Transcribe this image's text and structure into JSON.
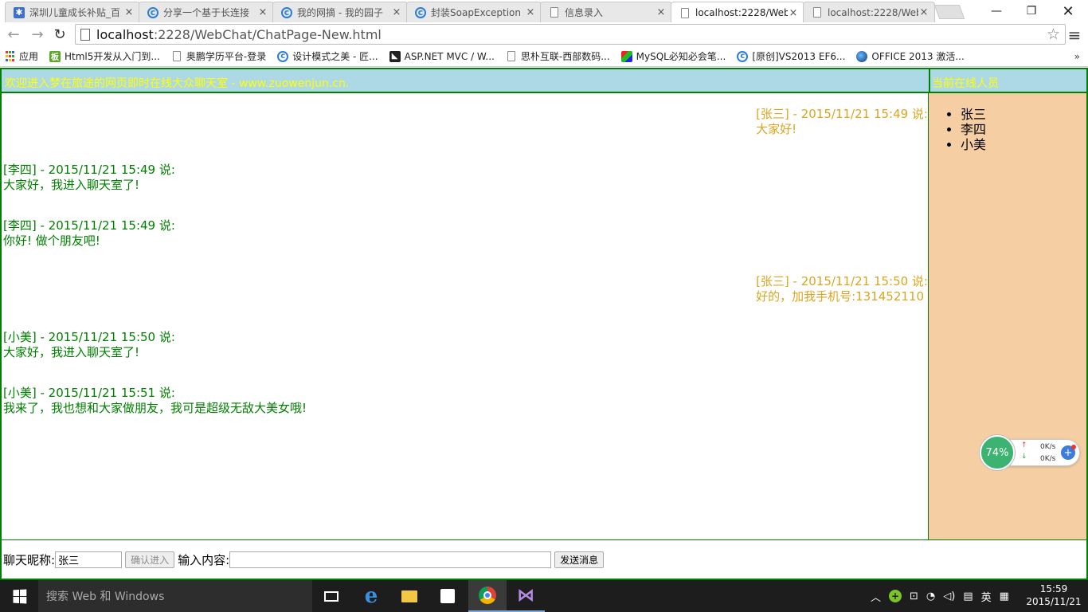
{
  "browser": {
    "tabs": [
      {
        "title": "深圳儿童成长补贴_百",
        "icon": "paw-icon",
        "active": false
      },
      {
        "title": "分享一个基于长连接",
        "icon": "blog-icon",
        "active": false
      },
      {
        "title": "我的网摘 - 我的园子",
        "icon": "blog-icon",
        "active": false
      },
      {
        "title": "封装SoapException",
        "icon": "blog-icon",
        "active": false
      },
      {
        "title": "信息录入",
        "icon": "page-icon",
        "active": false
      },
      {
        "title": "localhost:2228/Web",
        "icon": "page-icon",
        "active": true
      },
      {
        "title": "localhost:2228/Web",
        "icon": "page-icon",
        "active": false
      }
    ],
    "address": {
      "host": "localhost",
      "path": ":2228/WebChat/ChatPage-New.html"
    },
    "bookmarks": [
      {
        "label": "应用",
        "icon": "apps-grid-icon"
      },
      {
        "label": "Html5开发从入门到...",
        "icon": "green-square-icon"
      },
      {
        "label": "奥鹏学历平台-登录",
        "icon": "page-icon"
      },
      {
        "label": "设计模式之美 - 匠...",
        "icon": "blog-icon"
      },
      {
        "label": "ASP.NET MVC / W...",
        "icon": "dark-square-icon"
      },
      {
        "label": "思朴互联-西部数码...",
        "icon": "page-icon"
      },
      {
        "label": "MySQL必知必会笔...",
        "icon": "multicolor-icon"
      },
      {
        "label": "[原创]VS2013 EF6...",
        "icon": "blog-icon"
      },
      {
        "label": "OFFICE 2013 激活...",
        "icon": "sphere-icon"
      }
    ],
    "bookmarks_more": "»"
  },
  "chat": {
    "site_title": "欢迎进入梦在旅途的网页即时在线大众聊天室 - www.zuowenjun.cn.",
    "online_title": "当前在线人员",
    "messages": [
      {
        "side": "right",
        "header": "[张三] - 2015/11/21 15:49 说:",
        "body": "大家好!"
      },
      {
        "side": "left",
        "header": "[李四] - 2015/11/21 15:49 说:",
        "body": "大家好，我进入聊天室了!"
      },
      {
        "side": "left",
        "header": "[李四] - 2015/11/21 15:49 说:",
        "body": "你好! 做个朋友吧!"
      },
      {
        "side": "right",
        "header": "[张三] - 2015/11/21 15:50 说:",
        "body": "好的，加我手机号:131452110"
      },
      {
        "side": "left",
        "header": "[小美] - 2015/11/21 15:50 说:",
        "body": "大家好，我进入聊天室了!"
      },
      {
        "side": "left",
        "header": "[小美] - 2015/11/21 15:51 说:",
        "body": "我来了，我也想和大家做朋友，我可是超级无敌大美女哦!"
      }
    ],
    "online_users": [
      "张三",
      "李四",
      "小美"
    ],
    "input_bar": {
      "nick_label": "聊天昵称:",
      "nick_value": "张三",
      "confirm_label": "确认进入",
      "content_label": "输入内容:",
      "content_value": "",
      "send_label": "发送消息"
    },
    "colors": {
      "self_message": "#daa520",
      "other_message": "#008000",
      "header_bg": "#add8e6",
      "online_bg": "#f5cfa3",
      "border": "#008000"
    }
  },
  "speed_widget": {
    "percent": "74%",
    "upload": "0K/s",
    "download": "0K/s"
  },
  "taskbar": {
    "search_placeholder": "搜索 Web 和 Windows",
    "ime": "英",
    "time": "15:59",
    "date": "2015/11/21"
  }
}
